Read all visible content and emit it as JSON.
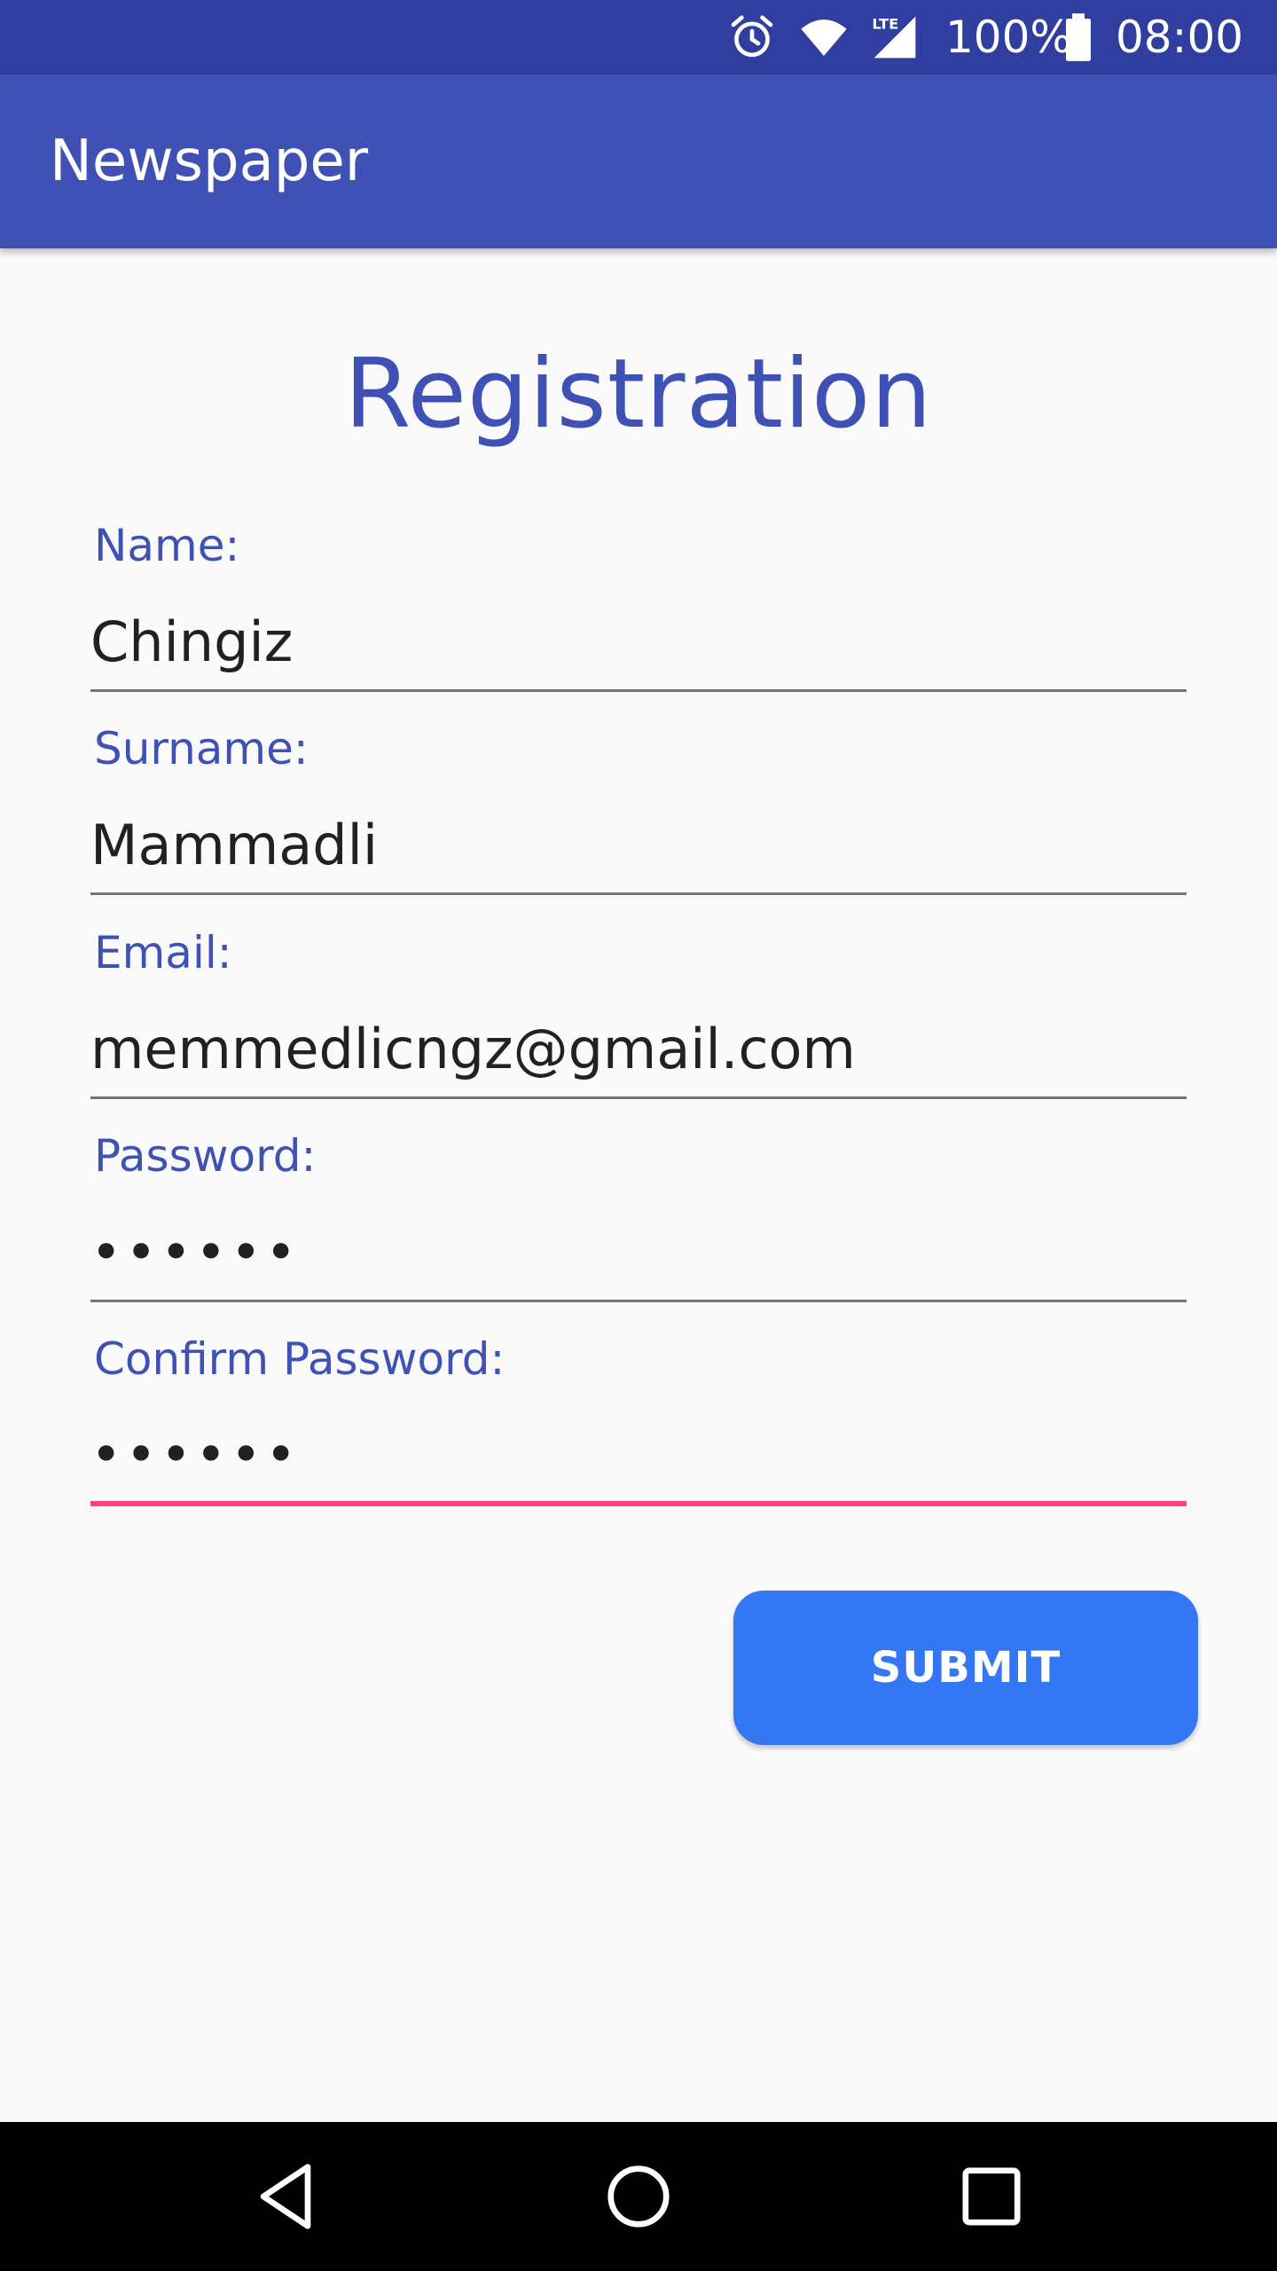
{
  "status_bar": {
    "battery_text": "100%",
    "time": "08:00",
    "network_label": "LTE",
    "icons": [
      "alarm-icon",
      "wifi-icon",
      "lte-signal-icon",
      "battery-icon"
    ]
  },
  "app_bar": {
    "title": "Newspaper"
  },
  "form": {
    "title": "Registration",
    "fields": [
      {
        "label": "Name:",
        "value": "Chingiz"
      },
      {
        "label": "Surname:",
        "value": "Mammadli"
      },
      {
        "label": "Email:",
        "value": "memmedlicngz@gmail.com"
      },
      {
        "label": "Password:",
        "value": "••••••"
      },
      {
        "label": "Confirm Password:",
        "value": "••••••"
      }
    ],
    "submit_label": "SUBMIT"
  },
  "nav_bar": {
    "icons": [
      "back-icon",
      "home-icon",
      "recents-icon"
    ]
  },
  "colors": {
    "status_bar": "#303F9F",
    "primary": "#3F51B5",
    "accent": "#FF4081",
    "button": "#3477F5",
    "background": "#FAFAFA"
  }
}
